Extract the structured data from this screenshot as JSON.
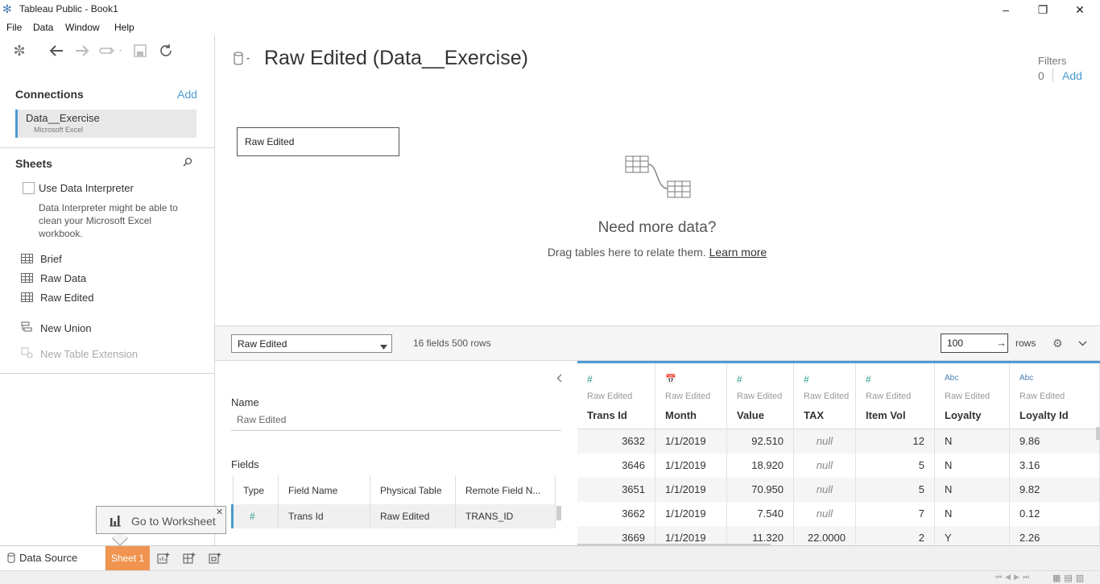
{
  "window": {
    "title": "Tableau Public - Book1",
    "minimize": "–",
    "restore": "❐",
    "close": "✕"
  },
  "menu": [
    "File",
    "Data",
    "Window",
    "Help"
  ],
  "connections": {
    "heading": "Connections",
    "add_label": "Add",
    "items": [
      {
        "name": "Data__Exercise",
        "type": "Microsoft Excel"
      }
    ]
  },
  "sheets": {
    "heading": "Sheets",
    "interpreter_label": "Use Data Interpreter",
    "interpreter_help": [
      "Data Interpreter might be able to",
      "clean your Microsoft Excel",
      "workbook."
    ],
    "items": [
      "Brief",
      "Raw Data",
      "Raw Edited"
    ],
    "new_union": "New Union",
    "new_table_extension": "New Table Extension"
  },
  "canvas": {
    "title": "Raw Edited (Data__Exercise)",
    "filters_label": "Filters",
    "filters_count": "0",
    "filters_add": "Add",
    "table_box": "Raw Edited",
    "need_more": "Need more data?",
    "drag_text": "Drag tables here to relate them.",
    "learn_more": "Learn more"
  },
  "grid_toolbar": {
    "selected_table": "Raw Edited",
    "summary": "16 fields 500 rows",
    "rows_value": "100",
    "rows_label": "rows"
  },
  "metadata": {
    "name_label": "Name",
    "name_value": "Raw Edited",
    "fields_label": "Fields",
    "columns": [
      "Type",
      "Field Name",
      "Physical Table",
      "Remote Field N..."
    ],
    "rows": [
      {
        "type": "#",
        "field": "Trans Id",
        "table": "Raw Edited",
        "remote": "TRANS_ID"
      }
    ]
  },
  "grid": {
    "source": "Raw Edited",
    "columns": [
      {
        "type": "#",
        "name": "Trans Id"
      },
      {
        "type": "📅",
        "name": "Month"
      },
      {
        "type": "#",
        "name": "Value"
      },
      {
        "type": "#",
        "name": "TAX"
      },
      {
        "type": "#",
        "name": "Item Vol"
      },
      {
        "type": "Abc",
        "name": "Loyalty"
      },
      {
        "type": "Abc",
        "name": "Loyalty Id"
      }
    ],
    "rows": [
      [
        "3632",
        "1/1/2019",
        "92.510",
        "null",
        "12",
        "N",
        "9.86"
      ],
      [
        "3646",
        "1/1/2019",
        "18.920",
        "null",
        "5",
        "N",
        "3.16"
      ],
      [
        "3651",
        "1/1/2019",
        "70.950",
        "null",
        "5",
        "N",
        "9.82"
      ],
      [
        "3662",
        "1/1/2019",
        "7.540",
        "null",
        "7",
        "N",
        "0.12"
      ],
      [
        "3669",
        "1/1/2019",
        "11.320",
        "22.0000",
        "2",
        "Y",
        "2.26"
      ]
    ]
  },
  "tabs": {
    "data_source": "Data Source",
    "sheet1": "Sheet 1"
  },
  "tooltip": {
    "text": "Go to Worksheet"
  }
}
